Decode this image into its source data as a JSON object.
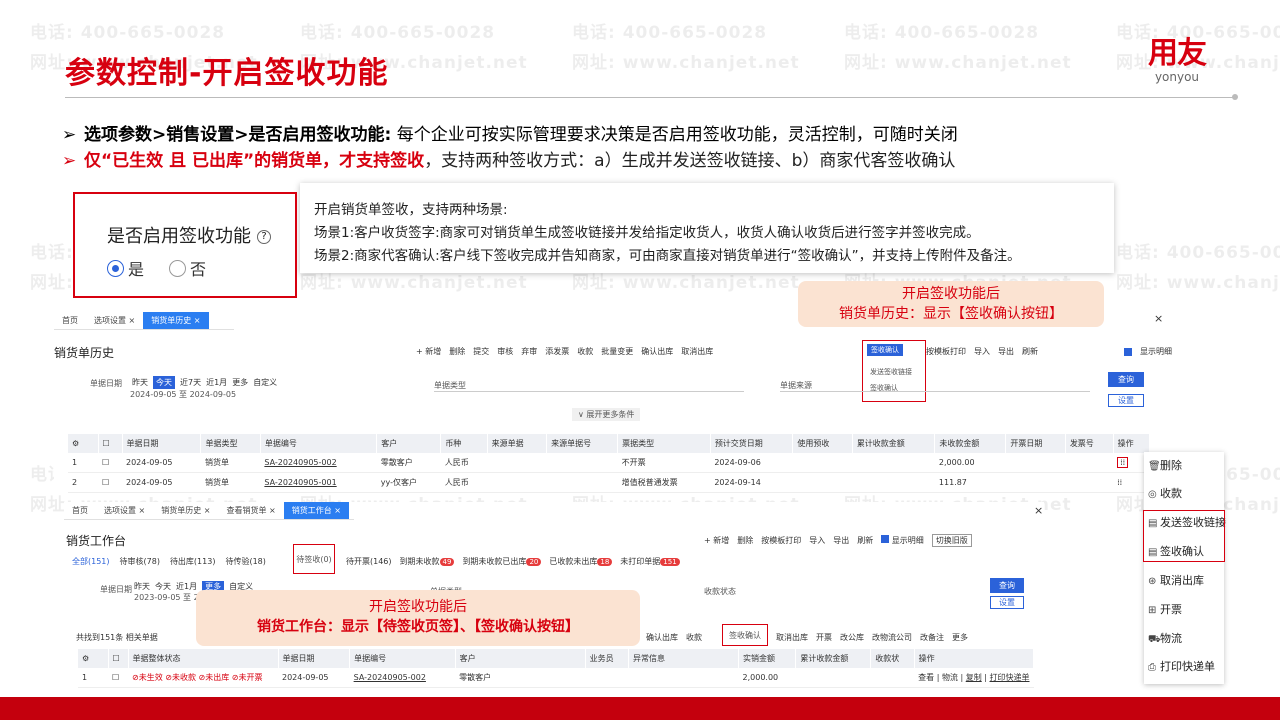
{
  "slide": {
    "title": "参数控制-开启签收功能",
    "logo_cn": "用友",
    "logo_en": "yonyou",
    "watermark_phone": "电话: 400-665-0028",
    "watermark_web": "网址: www.chanjet.net",
    "colors": {
      "brand_red": "#d7000f",
      "callout_bg": "#fbe3d2",
      "accent_blue": "#2b62d9"
    }
  },
  "bullets": {
    "b1_arrow": "➢",
    "b1_bold": "选项参数>销售设置>是否启用签收功能:",
    "b1_text": " 每个企业可按实际管理要求决策是否启用签收功能，灵活控制，可随时关闭",
    "b2_arrow": "➢",
    "b2_red": "仅“已生效 且 已出库”的销货单，才支持签收",
    "b2_text": "，支持两种签收方式：a）生成并发送签收链接、b）商家代客签收确认"
  },
  "option": {
    "label": "是否启用签收功能",
    "help_icon": "?",
    "yes": "是",
    "no": "否"
  },
  "desc": {
    "l1": "开启销货单签收，支持两种场景:",
    "l2": "场景1:客户收货签字:商家可对销货单生成签收链接并发给指定收货人，收货人确认收货后进行签字并签收完成。",
    "l3": "场景2:商家代客确认:客户线下签收完成并告知商家，可由商家直接对销货单进行“签收确认”，并支持上传附件及备注。"
  },
  "callout1": {
    "l1": "开启签收功能后",
    "l2": "销货单历史：显示【签收确认按钮】"
  },
  "callout2": {
    "l1": "开启签收功能后",
    "l2": "销货工作台：显示【待签收页签】、【签收确认按钮】"
  },
  "win1": {
    "tabs": [
      "首页",
      "选项设置 ×",
      "销货单历史 ×"
    ],
    "title": "销货单历史",
    "toolbar": [
      "+ 新增",
      "删除",
      "提交",
      "审核",
      "弃审",
      "添发票",
      "收款",
      "批量变更",
      "确认出库",
      "取消出库"
    ],
    "toolbar_active": "签收确认",
    "toolbar_right": [
      "按模板打印",
      "导入",
      "导出",
      "刷新"
    ],
    "show_detail": "显示明细",
    "dropdown": [
      "发送签收链接",
      "签收确认"
    ],
    "filter_date_label": "单据日期",
    "filter_chips": [
      "昨天",
      "今天",
      "近7天",
      "近1月",
      "更多",
      "自定义"
    ],
    "filter_range": "2024-09-05 至 2024-09-05",
    "filter_type": "单据类型",
    "filter_source": "单据来源",
    "query": "查询",
    "settings": "设置",
    "expand": "展开更多条件",
    "columns": [
      "单据日期",
      "单据类型",
      "单据编号",
      "客户",
      "币种",
      "来源单据",
      "来源单据号",
      "票据类型",
      "预计交货日期",
      "使用预收",
      "累计收款金额",
      "未收款金额",
      "开票日期",
      "发票号",
      "操作"
    ],
    "rows": [
      [
        "1",
        "2024-09-05",
        "销货单",
        "SA-20240905-002",
        "零散客户",
        "人民币",
        "",
        "",
        "不开票",
        "2024-09-06",
        "",
        "",
        "2,000.00",
        "",
        ""
      ],
      [
        "2",
        "2024-09-05",
        "销货单",
        "SA-20240905-001",
        "yy-仅客户",
        "人民币",
        "",
        "",
        "增值税普通发票",
        "2024-09-14",
        "",
        "",
        "111.87",
        "",
        ""
      ]
    ]
  },
  "menu": {
    "items": [
      "删除",
      "收款",
      "发送签收链接",
      "签收确认",
      "取消出库",
      "开票",
      "物流",
      "打印快递单"
    ]
  },
  "win2": {
    "tabs": [
      "首页",
      "选项设置 ×",
      "销货单历史 ×",
      "查看销货单 ×",
      "销货工作台 ×"
    ],
    "title": "销货工作台",
    "toolbar": [
      "+ 新增",
      "删除",
      "按模板打印",
      "导入",
      "导出",
      "刷新"
    ],
    "show_detail": "显示明细",
    "switch_old": "切换旧版",
    "status_tabs": [
      "全部(151)",
      "待审核(78)",
      "待出库(113)",
      "待传验(18)"
    ],
    "pending_tab": "待签收(0)",
    "status_tabs2": [
      "待开票(146)",
      "到期未收款",
      "到期未收款已出库",
      "已收款未出库",
      "未打印单据"
    ],
    "pills": [
      "49",
      "20",
      "18",
      "151"
    ],
    "filter_date_label": "单据日期",
    "filter_chips": [
      "昨天",
      "今天",
      "近1月",
      "更多",
      "自定义"
    ],
    "filter_range": "2023-09-05 至 2024",
    "filter_type": "单据类型",
    "filter_status": "收款状态",
    "query": "查询",
    "settings": "设置",
    "found": "共找到151条 相关单据",
    "action_bar": [
      "确认出库",
      "收款"
    ],
    "action_active": "签收确认",
    "action_bar2": [
      "取消出库",
      "开票",
      "改公库",
      "改物流公司",
      "改备注",
      "更多"
    ],
    "columns": [
      "单据整体状态",
      "单据日期",
      "单据编号",
      "客户",
      "业务员",
      "异常信息",
      "实销金额",
      "累计收款金额",
      "收款状",
      "操作"
    ],
    "row": {
      "idx": "1",
      "status": [
        "未生效",
        "未收款",
        "未出库",
        "未开票"
      ],
      "date": "2024-09-05",
      "no": "SA-20240905-002",
      "customer": "零散客户",
      "amount": "2,000.00",
      "ops": [
        "查看",
        "物流",
        "复制",
        "打印快递单"
      ]
    }
  }
}
